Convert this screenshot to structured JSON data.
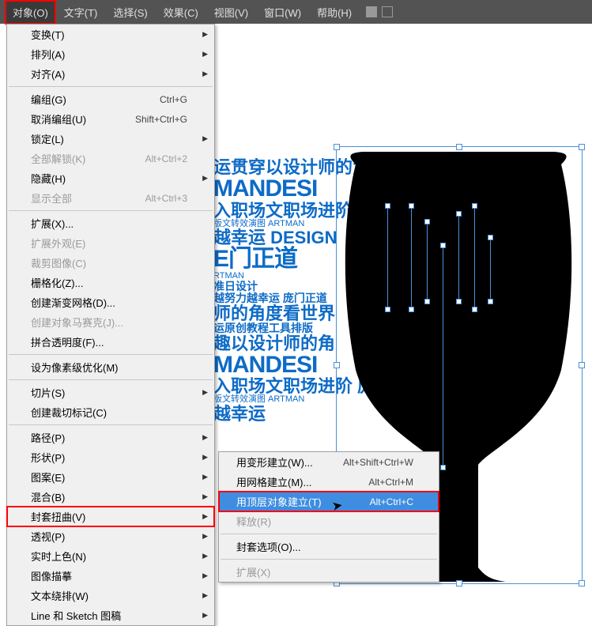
{
  "menubar": {
    "items": [
      {
        "label": "对象(O)",
        "active": true
      },
      {
        "label": "文字(T)"
      },
      {
        "label": "选择(S)"
      },
      {
        "label": "效果(C)"
      },
      {
        "label": "视图(V)"
      },
      {
        "label": "窗口(W)"
      },
      {
        "label": "帮助(H)"
      }
    ]
  },
  "object_menu": [
    {
      "label": "变换(T)",
      "sub": true
    },
    {
      "label": "排列(A)",
      "sub": true
    },
    {
      "label": "对齐(A)",
      "sub": true
    },
    {
      "sep": true
    },
    {
      "label": "编组(G)",
      "shortcut": "Ctrl+G"
    },
    {
      "label": "取消编组(U)",
      "shortcut": "Shift+Ctrl+G"
    },
    {
      "label": "锁定(L)",
      "sub": true
    },
    {
      "label": "全部解锁(K)",
      "shortcut": "Alt+Ctrl+2",
      "disabled": true
    },
    {
      "label": "隐藏(H)",
      "sub": true
    },
    {
      "label": "显示全部",
      "shortcut": "Alt+Ctrl+3",
      "disabled": true
    },
    {
      "sep": true
    },
    {
      "label": "扩展(X)..."
    },
    {
      "label": "扩展外观(E)",
      "disabled": true
    },
    {
      "label": "裁剪图像(C)",
      "disabled": true
    },
    {
      "label": "栅格化(Z)..."
    },
    {
      "label": "创建渐变网格(D)..."
    },
    {
      "label": "创建对象马赛克(J)...",
      "disabled": true
    },
    {
      "label": "拼合透明度(F)..."
    },
    {
      "sep": true
    },
    {
      "label": "设为像素级优化(M)"
    },
    {
      "sep": true
    },
    {
      "label": "切片(S)",
      "sub": true
    },
    {
      "label": "创建裁切标记(C)"
    },
    {
      "sep": true
    },
    {
      "label": "路径(P)",
      "sub": true
    },
    {
      "label": "形状(P)",
      "sub": true
    },
    {
      "label": "图案(E)",
      "sub": true
    },
    {
      "label": "混合(B)",
      "sub": true
    },
    {
      "label": "封套扭曲(V)",
      "sub": true,
      "red": true
    },
    {
      "label": "透视(P)",
      "sub": true
    },
    {
      "label": "实时上色(N)",
      "sub": true
    },
    {
      "label": "图像描摹",
      "sub": true
    },
    {
      "label": "文本绕排(W)",
      "sub": true
    },
    {
      "label": "Line 和 Sketch 图稿",
      "sub": true
    }
  ],
  "envelope_submenu": [
    {
      "label": "用变形建立(W)...",
      "shortcut": "Alt+Shift+Ctrl+W"
    },
    {
      "label": "用网格建立(M)...",
      "shortcut": "Alt+Ctrl+M"
    },
    {
      "label": "用顶层对象建立(T)",
      "shortcut": "Alt+Ctrl+C",
      "blue": true,
      "red": true
    },
    {
      "label": "释放(R)",
      "disabled": true
    },
    {
      "sep": true
    },
    {
      "label": "封套选项(O)..."
    },
    {
      "sep": true
    },
    {
      "label": "扩展(X)",
      "disabled": true
    }
  ],
  "typo": {
    "l1": "运贯穿以设计师的角",
    "l2": "MANDESI",
    "l3": "入职场文职场进阶",
    "l4": "版文转效演图 ARTMAN",
    "l5": "越幸运   DESIGN",
    "l6": "E门正道",
    "l7": "RTMAN",
    "l8": "准日设计",
    "l9": "越努力越幸运 庞门正道",
    "l10": "师的角度看世界",
    "l11": "运原创教程工具排版",
    "l12": "趣以设计师的角",
    "l13": "MANDESI",
    "l14": "入职场文职场进阶 庞",
    "l15": "版文转效演图 ARTMAN",
    "l16": "越幸运"
  }
}
